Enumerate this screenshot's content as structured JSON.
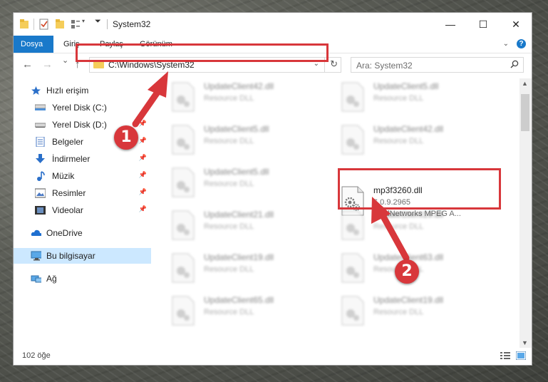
{
  "window": {
    "title": "System32",
    "controls": {
      "minimize": "—",
      "maximize": "☐",
      "close": "✕"
    }
  },
  "ribbon": {
    "tabs": [
      "Dosya",
      "Giriş",
      "Paylaş",
      "Görünüm"
    ],
    "help": "?"
  },
  "navbar": {
    "back": "←",
    "forward": "→",
    "recent": "⌄",
    "up": "↑",
    "address": "C:\\Windows\\System32",
    "search_placeholder": "Ara: System32"
  },
  "sidebar": {
    "items": [
      {
        "label": "Hızlı erişim",
        "icon": "star-icon",
        "pinned": false
      },
      {
        "label": "Yerel Disk (C:)",
        "icon": "drive-icon",
        "pinned": false
      },
      {
        "label": "Yerel Disk (D:)",
        "icon": "drive-icon",
        "pinned": true
      },
      {
        "label": "Belgeler",
        "icon": "documents-icon",
        "pinned": true
      },
      {
        "label": "İndirmeler",
        "icon": "download-icon",
        "pinned": true
      },
      {
        "label": "Müzik",
        "icon": "music-icon",
        "pinned": true
      },
      {
        "label": "Resimler",
        "icon": "pictures-icon",
        "pinned": true
      },
      {
        "label": "Videolar",
        "icon": "videos-icon",
        "pinned": true
      },
      {
        "label": "OneDrive",
        "icon": "cloud-icon",
        "pinned": false
      },
      {
        "label": "Bu bilgisayar",
        "icon": "computer-icon",
        "pinned": false,
        "selected": true
      },
      {
        "label": "Ağ",
        "icon": "network-icon",
        "pinned": false
      }
    ],
    "pin_glyph": "📌"
  },
  "files": {
    "left": [
      {
        "name": "UpdateClient42.dll",
        "type": "Resource DLL"
      },
      {
        "name": "UpdateClient5.dll",
        "type": "Resource DLL"
      },
      {
        "name": "UpdateClient5.dll",
        "type": "Resource DLL"
      },
      {
        "name": "UpdateClient21.dll",
        "type": "Resource DLL"
      },
      {
        "name": "UpdateClient19.dll",
        "type": "Resource DLL"
      },
      {
        "name": "UpdateClient65.dll",
        "type": "Resource DLL"
      }
    ],
    "right": [
      {
        "name": "UpdateClient5.dll",
        "type": "Resource DLL"
      },
      {
        "name": "UpdateClient42.dll",
        "type": "Resource DLL"
      },
      {
        "name": "mp3f3260.dll",
        "version": "6.0.9.2965",
        "description": "RealNetworks MPEG A...",
        "highlighted": true
      },
      {
        "name": "UpdateClient19.dll",
        "type": "Resource DLL"
      },
      {
        "name": "UpdateClient63.dll",
        "type": "Resource DLL"
      },
      {
        "name": "UpdateClient19.dll",
        "type": "Resource DLL"
      }
    ]
  },
  "status": {
    "count": "102 öğe"
  },
  "callouts": [
    "1",
    "2"
  ],
  "colors": {
    "accent": "#1979ca",
    "highlight": "#d8373b",
    "selected": "#cce8ff"
  }
}
